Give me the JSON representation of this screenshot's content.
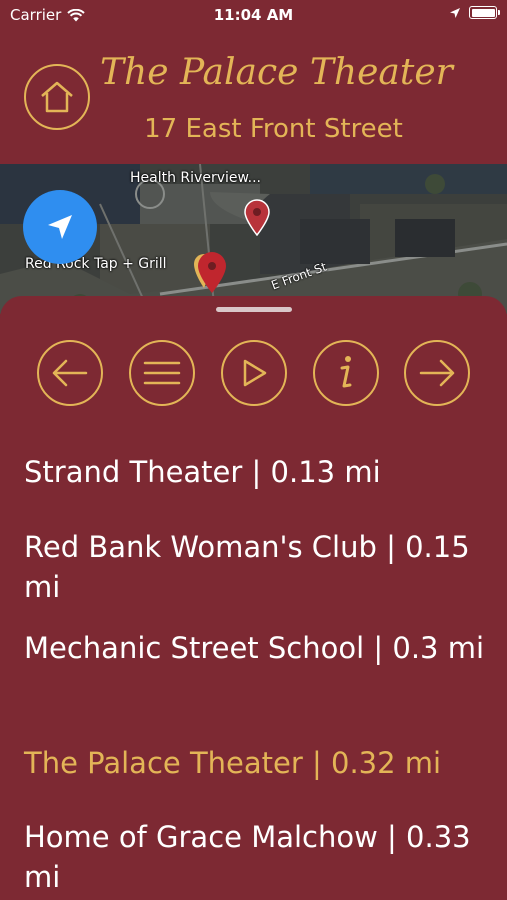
{
  "status_bar": {
    "carrier": "Carrier",
    "time": "11:04 AM",
    "icons": [
      "wifi-icon",
      "location-arrow-icon",
      "battery-icon"
    ]
  },
  "header": {
    "title": "The Palace Theater",
    "address": "17 East Front Street",
    "home_icon": "home-icon"
  },
  "map": {
    "labels": [
      "Health Riverview...",
      "Red Rock Tap + Grill",
      "E Front St"
    ],
    "locate_icon": "navigation-arrow-icon"
  },
  "controls": [
    {
      "name": "previous-button",
      "icon": "arrow-left-icon"
    },
    {
      "name": "list-button",
      "icon": "menu-icon"
    },
    {
      "name": "play-button",
      "icon": "play-icon"
    },
    {
      "name": "info-button",
      "icon": "info-icon"
    },
    {
      "name": "next-button",
      "icon": "arrow-right-icon"
    }
  ],
  "places": [
    {
      "label": "Strand Theater | 0.13 mi",
      "active": false
    },
    {
      "label": "Red Bank Woman's Club | 0.15 mi",
      "active": false
    },
    {
      "label": "Mechanic Street School | 0.3 mi",
      "active": false
    },
    {
      "label": "The Palace Theater | 0.32 mi",
      "active": true
    },
    {
      "label": "Home of Grace Malchow | 0.33 mi",
      "active": false
    }
  ],
  "colors": {
    "background": "#7d2933",
    "accent": "#e3b557",
    "text": "#ffffff",
    "locate_button": "#2f8ef0"
  }
}
